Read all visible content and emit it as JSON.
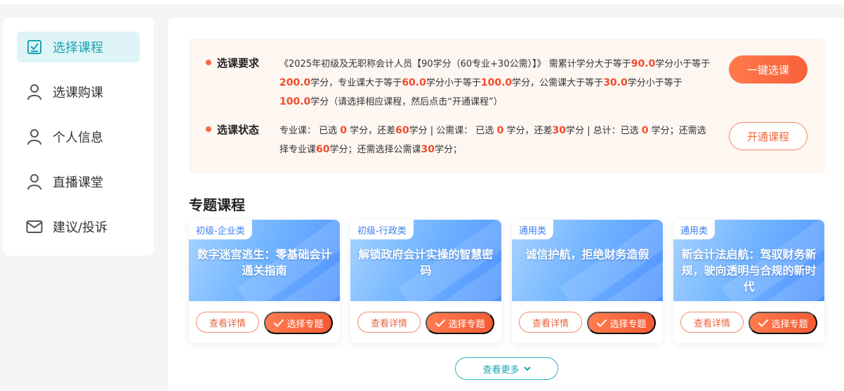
{
  "sidebar": {
    "items": [
      {
        "label": "选择课程",
        "icon": "checkbox-icon",
        "active": true
      },
      {
        "label": "选课购课",
        "icon": "user-icon",
        "active": false
      },
      {
        "label": "个人信息",
        "icon": "user-icon",
        "active": false
      },
      {
        "label": "直播课堂",
        "icon": "user-icon",
        "active": false
      },
      {
        "label": "建议/投诉",
        "icon": "mail-icon",
        "active": false
      }
    ]
  },
  "requirement": {
    "title": "选课要求",
    "parts": {
      "p1": "《2025年初级及无职称会计人员【90学分（60专业+30公需）】》 需累计学分大于等于",
      "v1": "90.0",
      "p2": "学分小于等于",
      "v2": "200.0",
      "p3": "学分，专业课大于等于",
      "v3": "60.0",
      "p4": "学分小于等于",
      "v4": "100.0",
      "p5": "学分，公需课大于等于",
      "v5": "30.0",
      "p6": "学分小于等于",
      "v6": "100.0",
      "p7": "学分（请选择相应课程，然后点击“开通课程”）"
    },
    "button": "一键选课"
  },
  "status": {
    "title": "选课状态",
    "parts": {
      "p1": "专业课：  已选 ",
      "v1": "0",
      "p2": " 学分，还差",
      "v2": "60",
      "p3": "学分 | 公需课：  已选 ",
      "v3": "0",
      "p4": " 学分，还差",
      "v4": "30",
      "p5": "学分 | 总计：已选 ",
      "v5": "0",
      "p6": " 学分；还需选择专业课",
      "v6": "60",
      "p7": "学分；还需选择公需课",
      "v7": "30",
      "p8": "学分；"
    },
    "button": "开通课程"
  },
  "section_title": "专题课程",
  "cards": [
    {
      "tag": "初级-企业类",
      "title": "数字迷宫逃生：零基础会计通关指南",
      "detail": "查看详情",
      "pick": "选择专题"
    },
    {
      "tag": "初级-行政类",
      "title": "解锁政府会计实操的智慧密码",
      "detail": "查看详情",
      "pick": "选择专题"
    },
    {
      "tag": "通用类",
      "title": "诚信护航，拒绝财务造假",
      "detail": "查看详情",
      "pick": "选择专题"
    },
    {
      "tag": "通用类",
      "title": "新会计法启航：驾驭财务新规，驶向透明与合规的新时代",
      "detail": "查看详情",
      "pick": "选择专题"
    }
  ],
  "more_button": "查看更多",
  "colors": {
    "accent_orange": "#f7613a",
    "accent_teal": "#1aa3b3",
    "highlight": "#f24b2c"
  }
}
